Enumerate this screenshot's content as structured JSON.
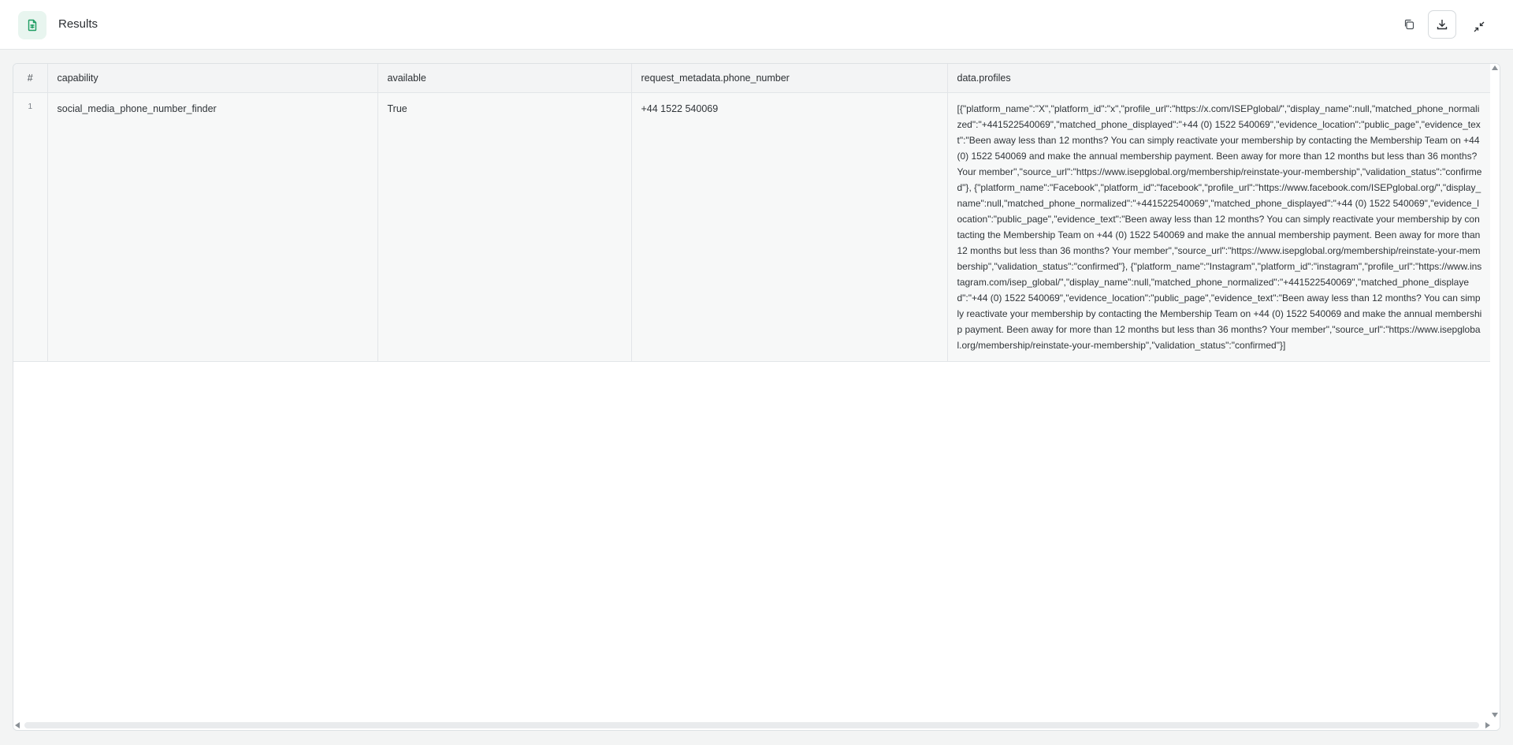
{
  "header": {
    "title": "Results",
    "icons": {
      "file": "file-spreadsheet-icon",
      "copy": "copy-icon",
      "download": "download-icon",
      "collapse": "collapse-icon"
    },
    "accent_color": "#1f9d63"
  },
  "table": {
    "columns": [
      "#",
      "capability",
      "available",
      "request_metadata.phone_number",
      "data.profiles"
    ],
    "rows": [
      {
        "index": "1",
        "capability": "social_media_phone_number_finder",
        "available": "True",
        "phone_number": "+44 1522 540069",
        "profiles": "[{\"platform_name\":\"X\",\"platform_id\":\"x\",\"profile_url\":\"https://x.com/ISEPglobal/\",\"display_name\":null,\"matched_phone_normalized\":\"+441522540069\",\"matched_phone_displayed\":\"+44 (0) 1522 540069\",\"evidence_location\":\"public_page\",\"evidence_text\":\"Been away less than 12 months? You can simply reactivate your membership by contacting the Membership Team on +44 (0) 1522 540069 and make the annual membership payment. Been away for more than 12 months but less than 36 months? Your member\",\"source_url\":\"https://www.isepglobal.org/membership/reinstate-your-membership\",\"validation_status\":\"confirmed\"}, {\"platform_name\":\"Facebook\",\"platform_id\":\"facebook\",\"profile_url\":\"https://www.facebook.com/ISEPglobal.org/\",\"display_name\":null,\"matched_phone_normalized\":\"+441522540069\",\"matched_phone_displayed\":\"+44 (0) 1522 540069\",\"evidence_location\":\"public_page\",\"evidence_text\":\"Been away less than 12 months? You can simply reactivate your membership by contacting the Membership Team on +44 (0) 1522 540069 and make the annual membership payment. Been away for more than 12 months but less than 36 months? Your member\",\"source_url\":\"https://www.isepglobal.org/membership/reinstate-your-membership\",\"validation_status\":\"confirmed\"}, {\"platform_name\":\"Instagram\",\"platform_id\":\"instagram\",\"profile_url\":\"https://www.instagram.com/isep_global/\",\"display_name\":null,\"matched_phone_normalized\":\"+441522540069\",\"matched_phone_displayed\":\"+44 (0) 1522 540069\",\"evidence_location\":\"public_page\",\"evidence_text\":\"Been away less than 12 months? You can simply reactivate your membership by contacting the Membership Team on +44 (0) 1522 540069 and make the annual membership payment. Been away for more than 12 months but less than 36 months? Your member\",\"source_url\":\"https://www.isepglobal.org/membership/reinstate-your-membership\",\"validation_status\":\"confirmed\"}]"
      }
    ]
  }
}
